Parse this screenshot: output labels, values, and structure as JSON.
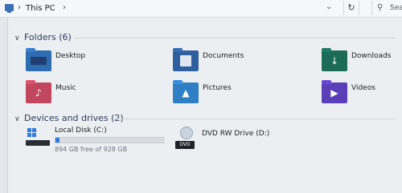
{
  "address_bar": {
    "breadcrumb": "This PC",
    "search_placeholder": "Sea"
  },
  "sections": {
    "folders_title": "Folders (6)",
    "devices_title": "Devices and drives (2)"
  },
  "folders": [
    {
      "label": "Desktop",
      "icon": "desktop-folder-icon",
      "color": "#2f6db3"
    },
    {
      "label": "Documents",
      "icon": "documents-folder-icon",
      "color": "#2f5f9e"
    },
    {
      "label": "Downloads",
      "icon": "downloads-folder-icon",
      "color": "#1c6b57"
    },
    {
      "label": "Music",
      "icon": "music-folder-icon",
      "color": "#c0475e"
    },
    {
      "label": "Pictures",
      "icon": "pictures-folder-icon",
      "color": "#2f7fc4"
    },
    {
      "label": "Videos",
      "icon": "videos-folder-icon",
      "color": "#5b3fb8"
    }
  ],
  "drives": [
    {
      "label": "Local Disk (C:)",
      "free_text": "894 GB free of 928 GB",
      "used_fraction": 0.037,
      "icon": "windows-drive-icon"
    },
    {
      "label": "DVD RW Drive (D:)",
      "badge": "DVD",
      "icon": "dvd-drive-icon"
    }
  ]
}
